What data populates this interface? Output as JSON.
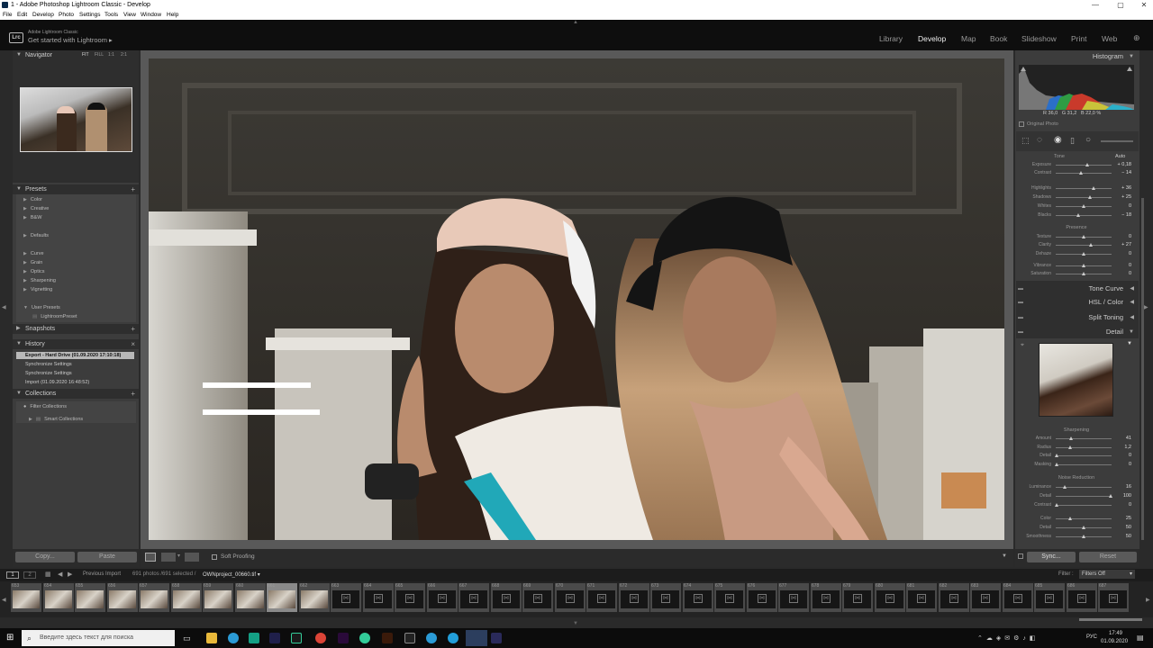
{
  "window": {
    "title": "1 - Adobe Photoshop Lightroom Classic - Develop",
    "controls": [
      "—",
      "▢",
      "✕"
    ]
  },
  "menu": [
    "File",
    "Edit",
    "Develop",
    "Photo",
    "Settings",
    "Tools",
    "View",
    "Window",
    "Help"
  ],
  "brand": {
    "line1": "Adobe Lightroom Classic",
    "line2": "Get started with Lightroom",
    "logo": "Lrc"
  },
  "modules": [
    "Library",
    "Develop",
    "Map",
    "Book",
    "Slideshow",
    "Print",
    "Web"
  ],
  "active_module": "Develop",
  "left": {
    "navigator": {
      "title": "Navigator",
      "zoom": [
        "FIT",
        "FILL",
        "1:1",
        "2:1"
      ]
    },
    "presets": {
      "title": "Presets",
      "items": [
        "Color",
        "Creative",
        "B&W",
        "Defaults",
        "Curve",
        "Grain",
        "Optics",
        "Sharpening",
        "Vignetting",
        "User Presets"
      ],
      "user_item": "LightroomPreset"
    },
    "snapshots": {
      "title": "Snapshots"
    },
    "history": {
      "title": "History",
      "items": [
        "Export - Hard Drive (01.09.2020 17:10:18)",
        "Synchronize Settings",
        "Synchronize Settings",
        "Import (01.09.2020 16:48:52)"
      ]
    },
    "collections": {
      "title": "Collections",
      "items": [
        "Filter Collections",
        "Smart Collections"
      ]
    },
    "copy": "Copy...",
    "paste": "Paste"
  },
  "toolbar": {
    "soft_proofing": "Soft Proofing"
  },
  "right": {
    "histogram": {
      "title": "Histogram",
      "r_label": "R",
      "r": "36,0",
      "g_label": "G",
      "g": "31,2",
      "b_label": "B",
      "b": "22,0",
      "pct": "%",
      "original_photo": "Original Photo"
    },
    "tone": {
      "title": "Tone",
      "auto": "Auto",
      "sliders": [
        {
          "label": "Exposure",
          "value": "+ 0,18",
          "pos": 0.56
        },
        {
          "label": "Contrast",
          "value": "− 14",
          "pos": 0.45
        },
        {
          "label": "Highlights",
          "value": "+ 36",
          "pos": 0.68
        },
        {
          "label": "Shadows",
          "value": "+ 25",
          "pos": 0.62
        },
        {
          "label": "Whites",
          "value": "0",
          "pos": 0.5
        },
        {
          "label": "Blacks",
          "value": "− 18",
          "pos": 0.41
        }
      ]
    },
    "presence": {
      "title": "Presence",
      "sliders": [
        {
          "label": "Texture",
          "value": "0",
          "pos": 0.5
        },
        {
          "label": "Clarity",
          "value": "+ 27",
          "pos": 0.63
        },
        {
          "label": "Dehaze",
          "value": "0",
          "pos": 0.5
        },
        {
          "label": "Vibrance",
          "value": "0",
          "pos": 0.5
        },
        {
          "label": "Saturation",
          "value": "0",
          "pos": 0.5
        }
      ]
    },
    "panels": [
      "Tone Curve",
      "HSL / Color",
      "Split Toning",
      "Detail"
    ],
    "sharpening": {
      "title": "Sharpening",
      "sliders": [
        {
          "label": "Amount",
          "value": "41",
          "pos": 0.27
        },
        {
          "label": "Radius",
          "value": "1,2",
          "pos": 0.25
        },
        {
          "label": "Detail",
          "value": "0",
          "pos": 0.02
        },
        {
          "label": "Masking",
          "value": "0",
          "pos": 0.02
        }
      ]
    },
    "noise": {
      "title": "Noise Reduction",
      "sliders": [
        {
          "label": "Luminance",
          "value": "16",
          "pos": 0.16
        },
        {
          "label": "Detail",
          "value": "100",
          "pos": 0.98
        },
        {
          "label": "Contrast",
          "value": "0",
          "pos": 0.02
        },
        {
          "label": "Color",
          "value": "25",
          "pos": 0.25
        },
        {
          "label": "Detail",
          "value": "50",
          "pos": 0.5
        },
        {
          "label": "Smoothness",
          "value": "50",
          "pos": 0.5
        }
      ]
    },
    "sync": "Sync...",
    "reset": "Reset"
  },
  "filmstrip": {
    "pages": [
      "1",
      "2"
    ],
    "source": "Previous Import",
    "count": "691 photos /691 selected /",
    "file": "OWNproject_00660.tif",
    "filter_label": "Filter :",
    "filter_value": "Filters Off",
    "cells": [
      "653",
      "654",
      "655",
      "656",
      "657",
      "658",
      "659",
      "660",
      "661",
      "662",
      "663",
      "664",
      "665",
      "666",
      "667",
      "668",
      "669",
      "670",
      "671",
      "672",
      "673",
      "674",
      "675",
      "676",
      "677",
      "678",
      "679",
      "680",
      "681",
      "682",
      "683",
      "684",
      "685",
      "686",
      "687"
    ]
  },
  "taskbar": {
    "search_placeholder": "Введите здесь текст для поиска",
    "lang": "РУС",
    "time": "17:49",
    "date": "01.09.2020"
  }
}
